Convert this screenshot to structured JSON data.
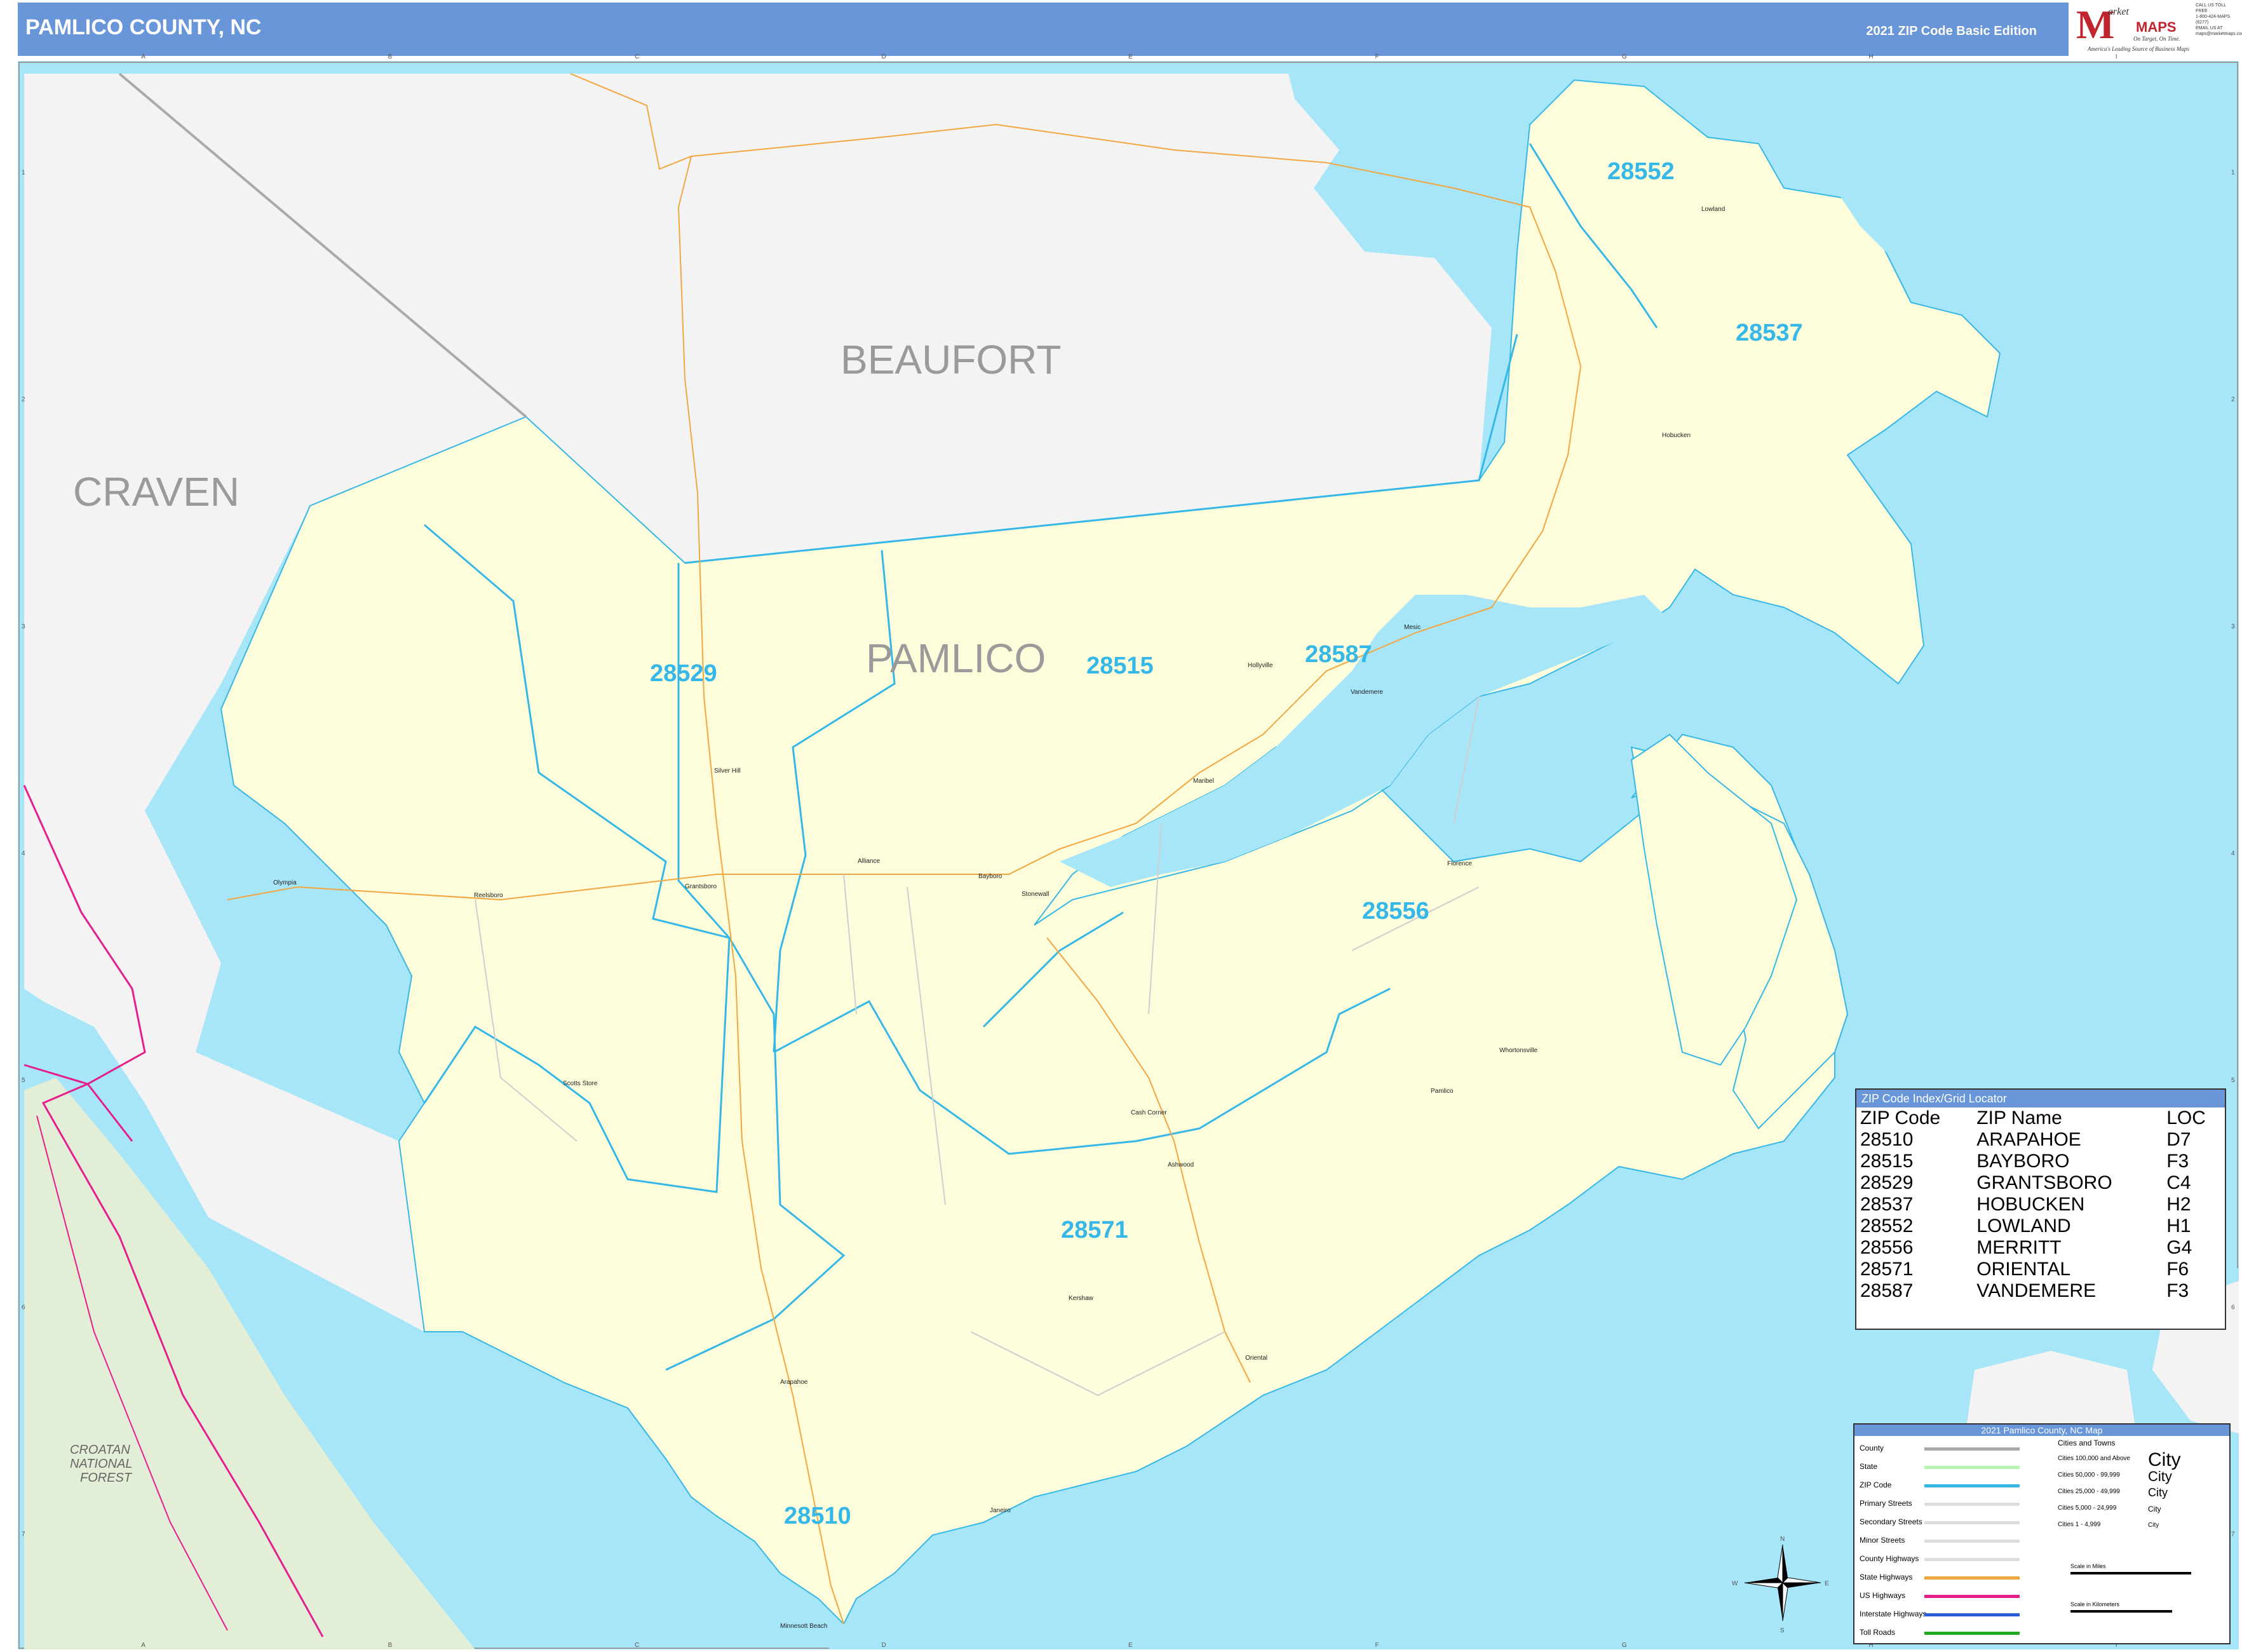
{
  "header": {
    "title": "PAMLICO COUNTY, NC",
    "edition": "2021 ZIP Code Basic Edition"
  },
  "logo": {
    "letter": "M",
    "word1": "arket",
    "word2": "MAPS",
    "tagline1": "On Target, On Time.",
    "tagline2": "America's Leading Source of Business Maps"
  },
  "contact": {
    "line1": "CALL US TOLL FREE",
    "line2": "1-800-424-MAPS (6277)",
    "line3": "EMAIL US AT",
    "line4": "maps@marketmaps.com"
  },
  "grid": {
    "columns": [
      "A",
      "B",
      "C",
      "D",
      "E",
      "F",
      "G",
      "H",
      "I"
    ],
    "rows": [
      "1",
      "2",
      "3",
      "4",
      "5",
      "6",
      "7"
    ]
  },
  "counties": {
    "beaufort": "BEAUFORT",
    "craven": "CRAVEN",
    "pamlico": "PAMLICO"
  },
  "forest": {
    "line1": "CROATAN",
    "line2": "NATIONAL",
    "line3": "FOREST"
  },
  "zips": {
    "z28552": "28552",
    "z28537": "28537",
    "z28529": "28529",
    "z28515": "28515",
    "z28587": "28587",
    "z28556": "28556",
    "z28571": "28571",
    "z28510": "28510"
  },
  "places": {
    "lowland": "Lowland",
    "hobucken": "Hobucken",
    "hollyville": "Hollyville",
    "vandemere": "Vandemere",
    "mesic": "Mesic",
    "silver_hill": "Silver Hill",
    "maribel": "Maribel",
    "alliance": "Alliance",
    "bayboro": "Bayboro",
    "stonewall": "Stonewall",
    "florence": "Florence",
    "grantsboro": "Grantsboro",
    "reelsboro": "Reelsboro",
    "olympia": "Olympia",
    "scotts_store": "Scotts Store",
    "whortonsville": "Whortonsville",
    "pamlico": "Pamlico",
    "cash_corner": "Cash Corner",
    "ashwood": "Ashwood",
    "kershaw": "Kershaw",
    "oriental": "Oriental",
    "arapahoe": "Arapahoe",
    "janeiro": "Janeiro",
    "minnesott_beach": "Minnesott Beach"
  },
  "zip_index": {
    "title": "ZIP Code Index/Grid Locator",
    "headers": [
      "ZIP Code",
      "ZIP Name",
      "LOC"
    ],
    "rows": [
      [
        "28510",
        "ARAPAHOE",
        "D7"
      ],
      [
        "28515",
        "BAYBORO",
        "F3"
      ],
      [
        "28529",
        "GRANTSBORO",
        "C4"
      ],
      [
        "28537",
        "HOBUCKEN",
        "H2"
      ],
      [
        "28552",
        "LOWLAND",
        "H1"
      ],
      [
        "28556",
        "MERRITT",
        "G4"
      ],
      [
        "28571",
        "ORIENTAL",
        "F6"
      ],
      [
        "28587",
        "VANDEMERE",
        "F3"
      ]
    ]
  },
  "legend": {
    "title": "2021 Pamlico County, NC Map",
    "rows": [
      "County",
      "State",
      "ZIP Code",
      "Primary Streets",
      "Secondary Streets",
      "Minor Streets",
      "County Highways",
      "State Highways",
      "US Highways",
      "Interstate Highways",
      "Toll Roads"
    ],
    "cities_title": "Cities and Towns",
    "city_classes": [
      "Cities 100,000 and Above",
      "Cities 50,000 - 99,999",
      "Cities 25,000 - 49,999",
      "Cities 5,000 - 24,999",
      "Cities 1 - 4,999"
    ],
    "city_sample": "City",
    "scale_miles": "Scale in Miles",
    "scale_km": "Scale in Kilometers",
    "colors": {
      "county": "#aaaaaa",
      "state": "#b6f2b0",
      "zip": "#35b8e8",
      "state_hwy": "#f2a640",
      "us_hwy": "#e61e8c",
      "interstate": "#2a5fd9",
      "toll": "#22aa22"
    }
  },
  "compass": {
    "n": "N",
    "s": "S",
    "e": "E",
    "w": "W"
  }
}
